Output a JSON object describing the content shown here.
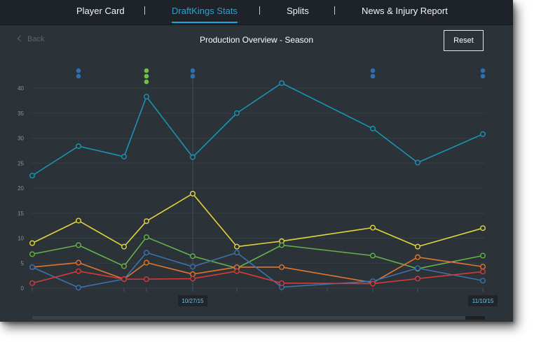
{
  "nav": {
    "items": [
      {
        "label": "Player Card",
        "active": false
      },
      {
        "label": "DraftKings Stats",
        "active": true
      },
      {
        "label": "Splits",
        "active": false
      },
      {
        "label": "News & Injury Report",
        "active": false
      }
    ],
    "separator": "|"
  },
  "header": {
    "back_label": "Back",
    "back_icon": "chevron-left-icon",
    "title": "Production Overview - Season",
    "reset_label": "Reset"
  },
  "colors": {
    "accent": "#1ea6dc",
    "background": "#2b3238",
    "nav_background": "#1d2328"
  },
  "chart_data": {
    "type": "line",
    "title": "Production Overview - Season",
    "xlabel": "",
    "ylabel": "",
    "ylim": [
      0,
      42
    ],
    "yticks": [
      0,
      5,
      10,
      15,
      20,
      25,
      30,
      35,
      40
    ],
    "grid": true,
    "x_labels": [
      {
        "index": 4,
        "label": "10/27/15"
      },
      {
        "index": 10,
        "label": "11/10/15"
      }
    ],
    "highlight_index": 4,
    "series": [
      {
        "color": "#1b93b3",
        "values": [
          22.5,
          28.4,
          26.3,
          38.3,
          26.2,
          35,
          41,
          null,
          31.9,
          25.1,
          30.8
        ]
      },
      {
        "color": "#e2d53c",
        "values": [
          9,
          13.5,
          8.3,
          13.4,
          18.9,
          8.3,
          9.4,
          null,
          12.1,
          8.3,
          12
        ]
      },
      {
        "color": "#66b24a",
        "values": [
          6.8,
          8.6,
          4.4,
          10.2,
          6.4,
          4,
          8.6,
          null,
          6.5,
          3.9,
          6.5
        ]
      },
      {
        "color": "#e0762e",
        "values": [
          4.2,
          5.1,
          1.8,
          5.1,
          2.8,
          4.2,
          4.2,
          null,
          1.1,
          6.2,
          4.3
        ]
      },
      {
        "color": "#3c72ad",
        "values": [
          4.2,
          0.1,
          1.8,
          7.1,
          4.3,
          7.1,
          0.2,
          null,
          1.4,
          4.0,
          1.5
        ]
      },
      {
        "color": "#d63a3a",
        "values": [
          1.0,
          3.4,
          1.8,
          1.8,
          1.9,
          3.4,
          1.0,
          null,
          0.9,
          1.9,
          3.3
        ]
      }
    ],
    "event_markers": [
      {
        "index": 1,
        "count": 2,
        "color": "#2f6fb0"
      },
      {
        "index": 3,
        "count": 3,
        "color": "#6fc04a"
      },
      {
        "index": 4,
        "count": 2,
        "color": "#2f6fb0"
      },
      {
        "index": 8,
        "count": 2,
        "color": "#2f6fb0"
      },
      {
        "index": 10,
        "count": 2,
        "color": "#2f6fb0"
      }
    ]
  }
}
